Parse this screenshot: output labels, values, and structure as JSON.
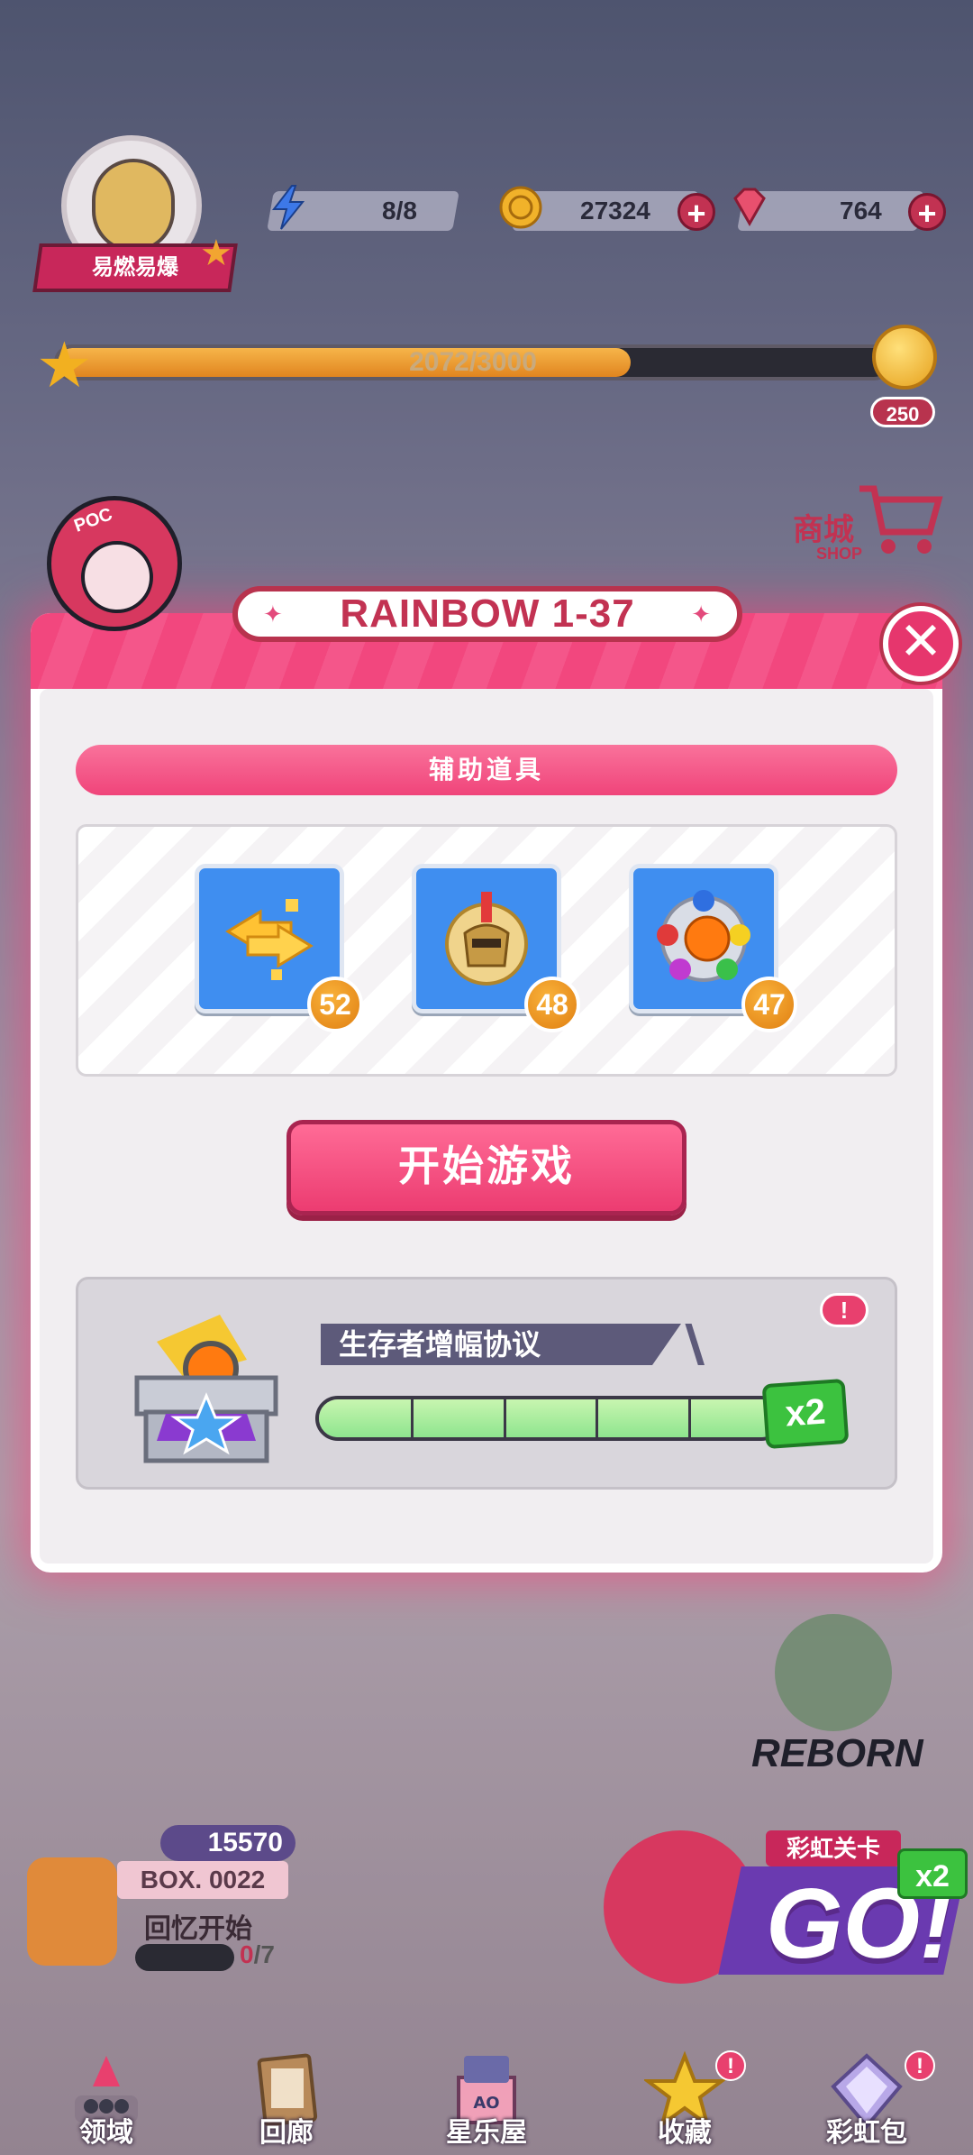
{
  "player": {
    "name": "易燃易爆"
  },
  "resources": {
    "energy": "8/8",
    "coins": "27324",
    "gems": "764"
  },
  "level_progress": {
    "text": "2072/3000",
    "fraction": 0.69,
    "reward": "250"
  },
  "shop": {
    "label": "商城",
    "sub": "SHOP"
  },
  "modal": {
    "title": "RAINBOW 1-37",
    "section_title": "辅助道具",
    "items": [
      {
        "name": "swap-arrows",
        "count": "52"
      },
      {
        "name": "spartan-helmet",
        "count": "48"
      },
      {
        "name": "rainbow-ball",
        "count": "47"
      }
    ],
    "start_button": "开始游戏",
    "boost": {
      "title": "生存者增幅协议",
      "alert": "!",
      "multiplier": "x2",
      "segments": 5,
      "fraction": 0.98
    },
    "mascot_tag": "POC"
  },
  "background": {
    "reborn_label": "REBORN",
    "box": {
      "gems": "15570",
      "title": "BOX. 0022",
      "subtitle": "回忆开始",
      "count_current": "0",
      "count_total": "/7"
    },
    "go_card": {
      "tag": "彩虹关卡",
      "big": "GO!",
      "multiplier": "x2"
    }
  },
  "nav": [
    {
      "label": "领域",
      "icon": "domain-icon",
      "alert": ""
    },
    {
      "label": "回廊",
      "icon": "gallery-icon",
      "alert": ""
    },
    {
      "label": "星乐屋",
      "icon": "house-icon",
      "alert": ""
    },
    {
      "label": "收藏",
      "icon": "star-icon",
      "alert": "!"
    },
    {
      "label": "彩虹包",
      "icon": "diamond-pack-icon",
      "alert": "!"
    }
  ],
  "colors": {
    "accent_pink": "#ec3c71",
    "modal_header": "#f2477e",
    "item_blue": "#3f8ef0",
    "count_orange": "#e07f12",
    "boost_green": "#3cc23f"
  }
}
